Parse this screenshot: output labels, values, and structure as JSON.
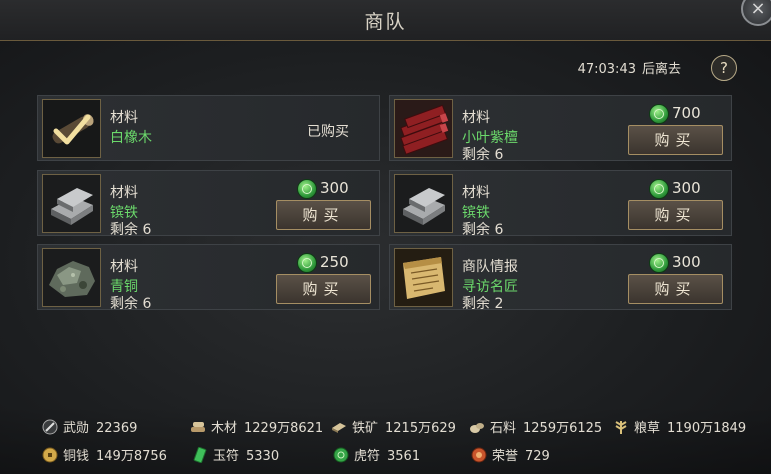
{
  "window": {
    "title": "商队",
    "close_icon": "×"
  },
  "timer": {
    "time": "47:03:43",
    "suffix": "后离去"
  },
  "help": {
    "label": "?"
  },
  "items": [
    {
      "category": "材料",
      "name": "白橡木",
      "status": "已购买",
      "image": "white-oak-logs",
      "purchased": true
    },
    {
      "category": "材料",
      "name": "小叶紫檀",
      "price": "700",
      "remaining": "剩余 6",
      "buy_label": "购买",
      "image": "red-sandalwood"
    },
    {
      "category": "材料",
      "name": "镔铁",
      "price": "300",
      "remaining": "剩余 6",
      "buy_label": "购买",
      "image": "iron-ingots"
    },
    {
      "category": "材料",
      "name": "镔铁",
      "price": "300",
      "remaining": "剩余 6",
      "buy_label": "购买",
      "image": "iron-ingots"
    },
    {
      "category": "材料",
      "name": "青铜",
      "price": "250",
      "remaining": "剩余 6",
      "buy_label": "购买",
      "image": "bronze-ore"
    },
    {
      "category": "商队情报",
      "name": "寻访名匠",
      "price": "300",
      "remaining": "剩余 2",
      "buy_label": "购买",
      "image": "scroll"
    }
  ],
  "resources": {
    "merit": {
      "label": "武勋",
      "value": "22369"
    },
    "wood": {
      "label": "木材",
      "value": "1229万8621"
    },
    "iron": {
      "label": "铁矿",
      "value": "1215万629"
    },
    "stone": {
      "label": "石料",
      "value": "1259万6125"
    },
    "grain": {
      "label": "粮草",
      "value": "1190万1849"
    },
    "copper": {
      "label": "铜钱",
      "value": "149万8756"
    },
    "jade": {
      "label": "玉符",
      "value": "5330"
    },
    "tiger": {
      "label": "虎符",
      "value": "3561"
    },
    "honor": {
      "label": "荣誉",
      "value": "729"
    }
  },
  "colors": {
    "item_name": "#6bd86b",
    "accent_gold": "#a58e63",
    "jade_green": "#2f9a3b"
  }
}
